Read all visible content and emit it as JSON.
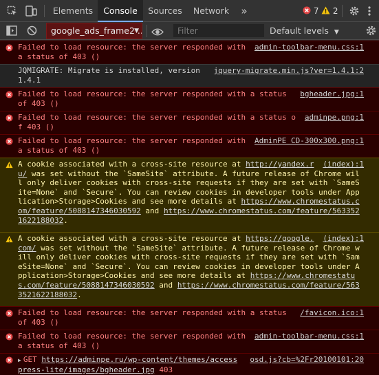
{
  "toolbar": {
    "tabs": [
      "Elements",
      "Console",
      "Sources",
      "Network"
    ],
    "more_label": "»",
    "error_count": "7",
    "warning_count": "2"
  },
  "filterbar": {
    "context": "google_ads_frame2 ...",
    "filter_placeholder": "Filter",
    "levels_label": "Default levels"
  },
  "messages": [
    {
      "level": "error",
      "src": "admin-toolbar-menu.css:1",
      "text": "Failed to load resource: the server responded with a status of 403 ()"
    },
    {
      "level": "info",
      "src": "jquery-migrate.min.js?ver=1.4.1:2",
      "text": "JQMIGRATE: Migrate is installed, version 1.4.1"
    },
    {
      "level": "error",
      "src": "bgheader.jpg:1",
      "text": "Failed to load resource: the server responded with a status of 403 ()"
    },
    {
      "level": "error",
      "src": "adminpe.png:1",
      "text": "Failed to load resource: the server responded with a status of 403 ()"
    },
    {
      "level": "error",
      "src": "AdminPE CD-300x300.png:1",
      "text": "Failed to load resource: the server responded with a status of 403 ()"
    },
    {
      "level": "warn",
      "src": "(index):1",
      "pre": "A cookie associated with a cross-site resource at ",
      "url": "http://yandex.ru/",
      "post": " was set without the `SameSite` attribute. A future release of Chrome will only deliver cookies with cross-site requests if they are set with `SameSite=None` and `Secure`. You can review cookies in developer tools under Application>Storage>Cookies and see more details at ",
      "link1": "https://www.chromestatus.com/feature/5088147346030592",
      "mid": " and ",
      "link2": "https://www.chromestatus.com/feature/5633521622188032",
      "end": "."
    },
    {
      "level": "warn",
      "src": "(index):1",
      "pre": "A cookie associated with a cross-site resource at ",
      "url": "https://google.com/",
      "post": " was set without the `SameSite` attribute. A future release of Chrome will only deliver cookies with cross-site requests if they are set with `SameSite=None` and `Secure`. You can review cookies in developer tools under Application>Storage>Cookies and see more details at ",
      "link1": "https://www.chromestatus.com/feature/5088147346030592",
      "mid": " and ",
      "link2": "https://www.chromestatus.com/feature/5633521622188032",
      "end": "."
    },
    {
      "level": "error",
      "src": "/favicon.ico:1",
      "text": "Failed to load resource: the server responded with a status of 403 ()"
    },
    {
      "level": "error",
      "src": "admin-toolbar-menu.css:1",
      "text": "Failed to load resource: the server responded with a status of 403 ()"
    },
    {
      "level": "error",
      "src": "osd.js?cb=%2Fr20100101:20",
      "method": "GET",
      "url": "https://adminpe.ru/wp-content/themes/accesspress-lite/images/bgheader.jpg",
      "status": "403"
    }
  ]
}
